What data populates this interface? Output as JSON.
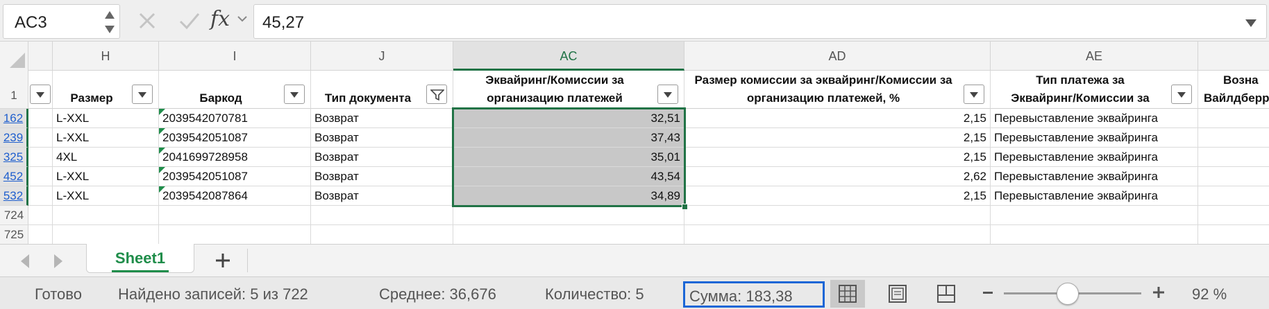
{
  "formula_bar": {
    "name_box": "AC3",
    "fx_label": "fx",
    "value": "45,27"
  },
  "columns": [
    {
      "id": "H",
      "label": "H"
    },
    {
      "id": "I",
      "label": "I"
    },
    {
      "id": "J",
      "label": "J"
    },
    {
      "id": "AC",
      "label": "AC"
    },
    {
      "id": "AD",
      "label": "AD"
    },
    {
      "id": "AE",
      "label": "AE"
    }
  ],
  "header_row": {
    "row_number": "1",
    "H": "Размер",
    "I": "Баркод",
    "J": "Тип документа",
    "AC_line1": "Эквайринг/Комиссии за",
    "AC_line2": "организацию платежей",
    "AD_line1": "Размер комиссии за эквайринг/Комиссии за",
    "AD_line2": "организацию платежей, %",
    "AE_line1": "Тип платежа за",
    "AE_line2": "Эквайринг/Комиссии за",
    "AF_line1": "Возна",
    "AF_line2": "Вайлдберр"
  },
  "rows": [
    {
      "num": "162",
      "H": "L-XXL",
      "I": "2039542070781",
      "J": "Возврат",
      "AC": "32,51",
      "AD": "2,15",
      "AE": "Перевыставление эквайринга"
    },
    {
      "num": "239",
      "H": "L-XXL",
      "I": "2039542051087",
      "J": "Возврат",
      "AC": "37,43",
      "AD": "2,15",
      "AE": "Перевыставление эквайринга"
    },
    {
      "num": "325",
      "H": "4XL",
      "I": "2041699728958",
      "J": "Возврат",
      "AC": "35,01",
      "AD": "2,15",
      "AE": "Перевыставление эквайринга"
    },
    {
      "num": "452",
      "H": "L-XXL",
      "I": "2039542051087",
      "J": "Возврат",
      "AC": "43,54",
      "AD": "2,62",
      "AE": "Перевыставление эквайринга"
    },
    {
      "num": "532",
      "H": "L-XXL",
      "I": "2039542087864",
      "J": "Возврат",
      "AC": "34,89",
      "AD": "2,15",
      "AE": "Перевыставление эквайринга"
    }
  ],
  "empty_rows": [
    "724",
    "725"
  ],
  "sheets": {
    "active": "Sheet1",
    "add_label": "+"
  },
  "status": {
    "ready": "Готово",
    "found": "Найдено записей: 5 из 722",
    "average": "Среднее: 36,676",
    "count": "Количество: 5",
    "sum": "Сумма: 183,38",
    "zoom": "92 %"
  },
  "colors": {
    "accent": "#217346",
    "tab_green": "#1f8d4a",
    "sum_highlight": "#1a66d6",
    "row_link": "#1f5fce"
  }
}
